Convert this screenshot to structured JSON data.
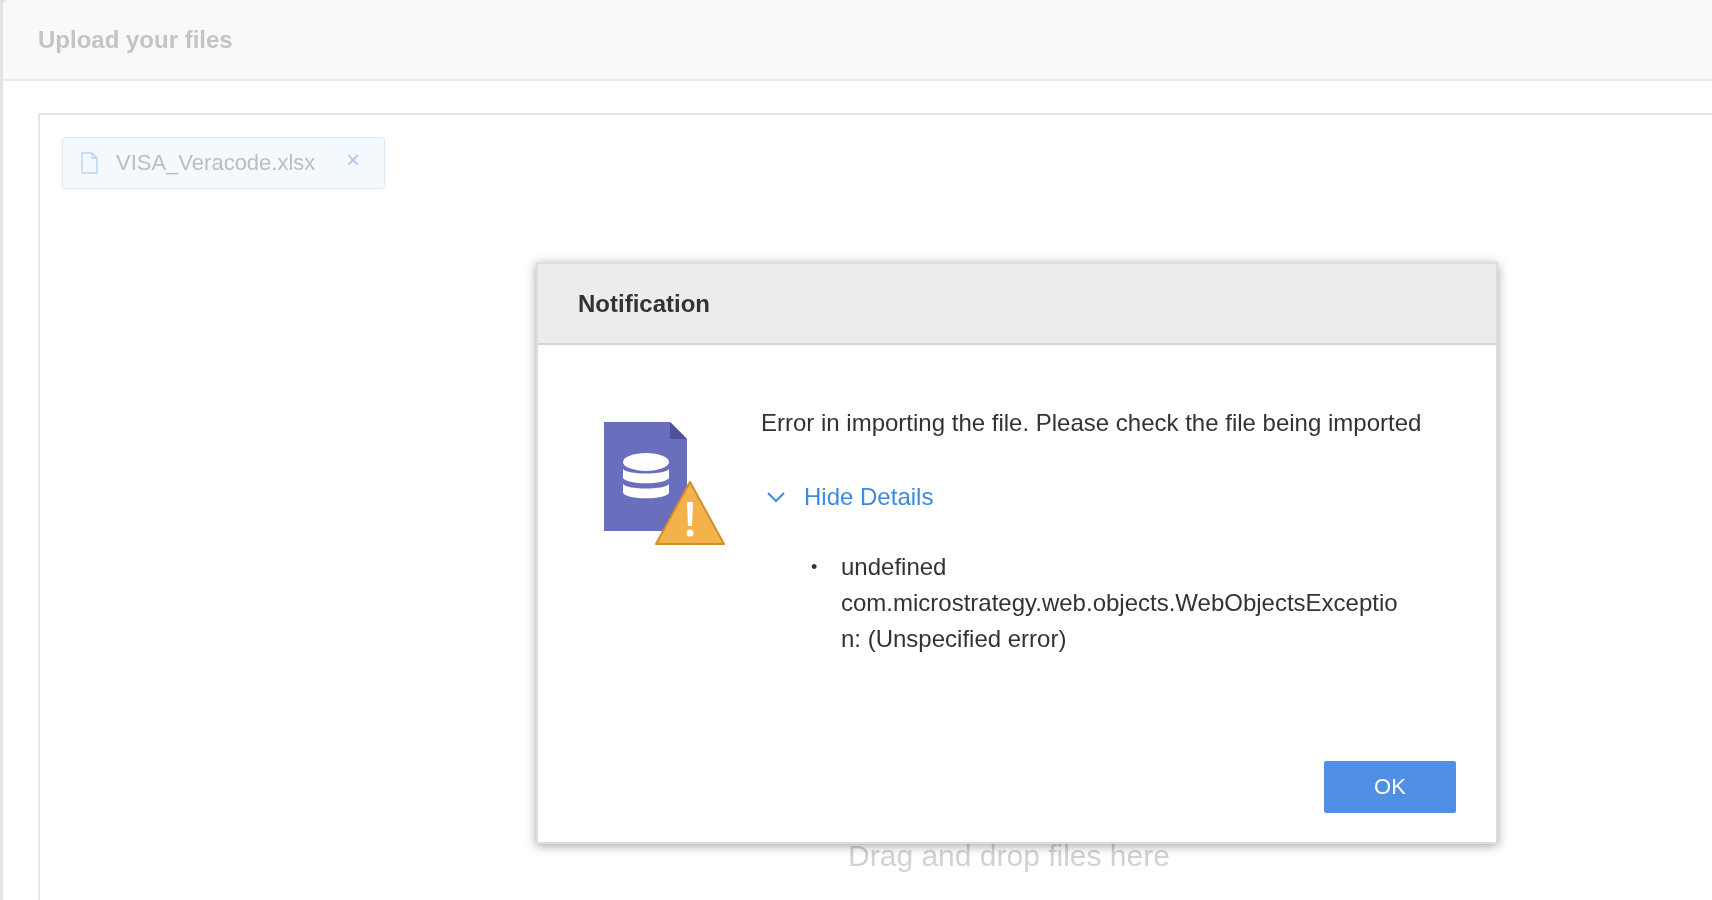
{
  "page": {
    "title": "Upload your files"
  },
  "upload_area": {
    "files": [
      {
        "name": "VISA_Veracode.xlsx",
        "remove": "×"
      }
    ],
    "hint": "Drag and drop files here"
  },
  "dialog": {
    "title": "Notification",
    "message": "Error in importing the file. Please check the file being imported",
    "details_toggle": {
      "label": "Hide Details",
      "expanded": true
    },
    "details": [
      {
        "bullet": "•",
        "text": "undefined com.microstrategy.web.objects.WebObjectsException: (Unspecified error)"
      }
    ],
    "buttons": [
      {
        "label": "OK"
      }
    ]
  }
}
